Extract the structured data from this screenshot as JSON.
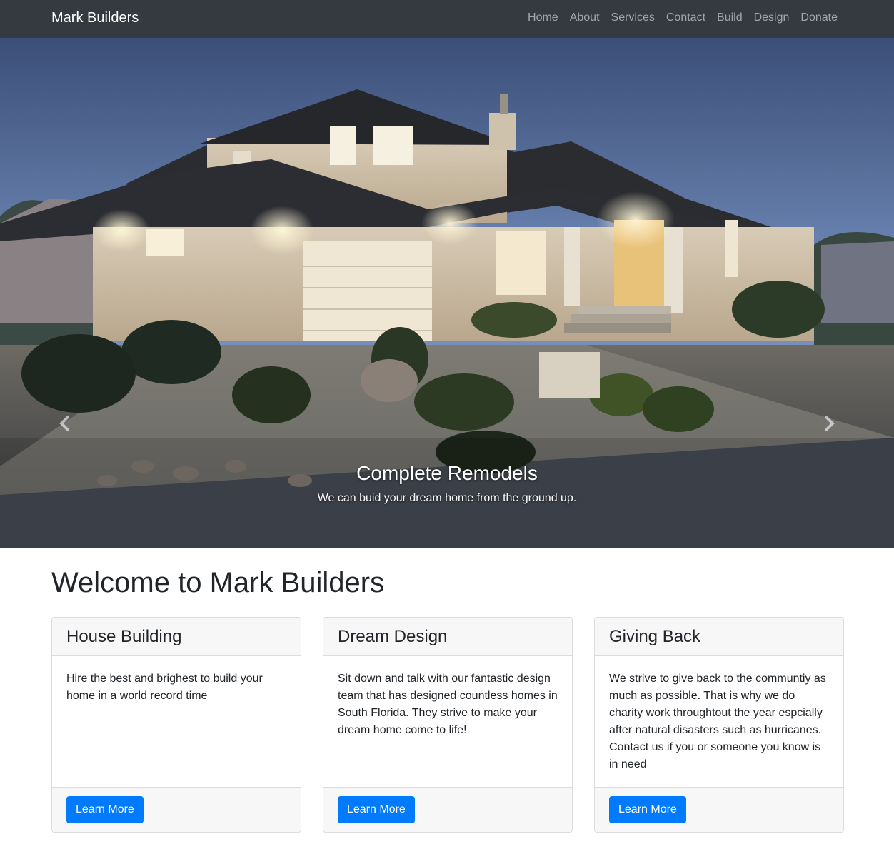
{
  "navbar": {
    "brand": "Mark Builders",
    "links": [
      "Home",
      "About",
      "Services",
      "Contact",
      "Build",
      "Design",
      "Donate"
    ]
  },
  "hero": {
    "caption_title": "Complete Remodels",
    "caption_text": "We can buid your dream home from the ground up.",
    "prev_icon": "chevron-left-icon",
    "next_icon": "chevron-right-icon"
  },
  "welcome_title": "Welcome to Mark Builders",
  "cards": [
    {
      "title": "House Building",
      "text": "Hire the best and brighest to build your home in a world record time",
      "button": "Learn More"
    },
    {
      "title": "Dream Design",
      "text": "Sit down and talk with our fantastic design team that has designed countless homes in South Florida. They strive to make your dream home come to life!",
      "button": "Learn More"
    },
    {
      "title": "Giving Back",
      "text": "We strive to give back to the communtiy as much as possible. That is why we do charity work throughtout the year espcially after natural disasters such as hurricanes. Contact us if you or someone you know is in need",
      "button": "Learn More"
    }
  ],
  "colors": {
    "navbar_bg": "#343a40",
    "primary": "#007bff",
    "card_header_bg": "#f7f7f7"
  }
}
